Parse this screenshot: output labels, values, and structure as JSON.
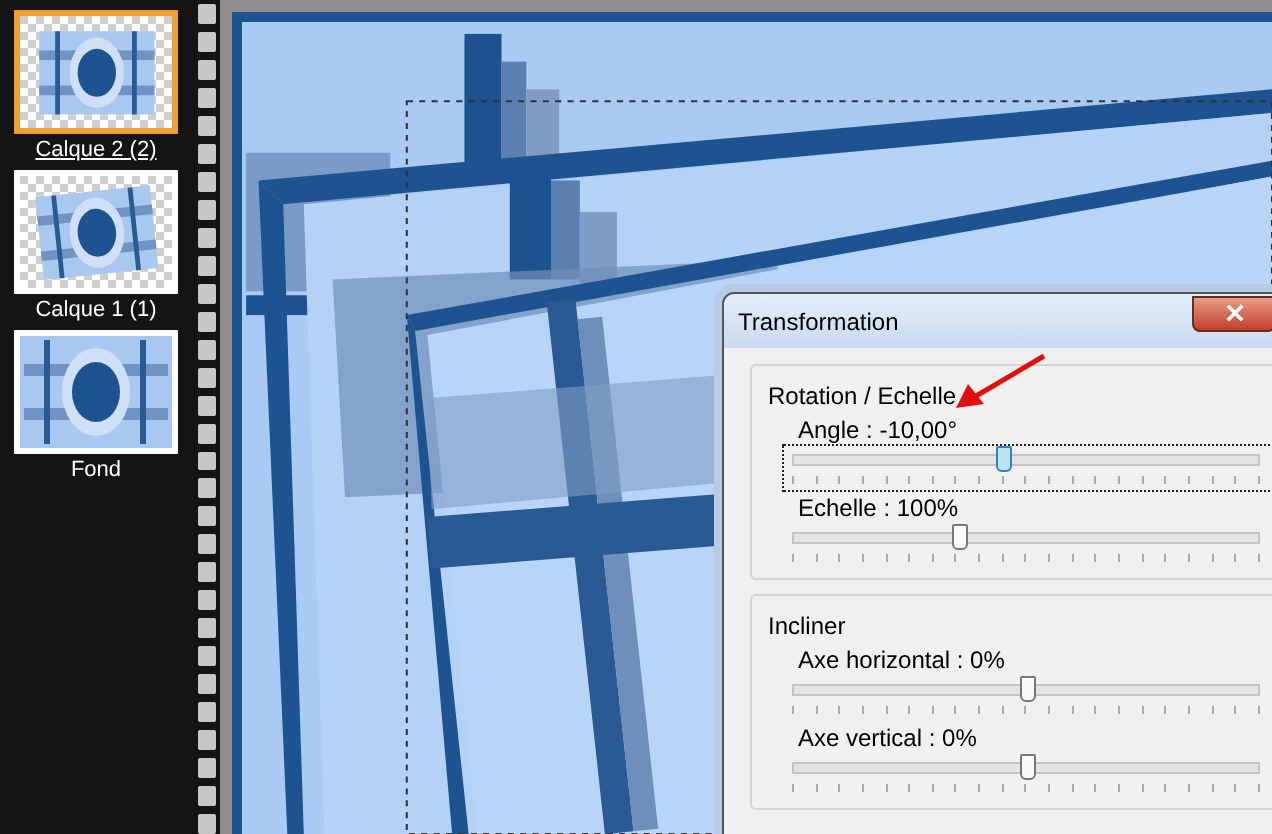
{
  "layers": [
    {
      "name": "Calque 2 (2)",
      "selected": true,
      "transparent": true
    },
    {
      "name": "Calque 1 (1)",
      "selected": false,
      "transparent": true
    },
    {
      "name": "Fond",
      "selected": false,
      "transparent": false
    }
  ],
  "dialog": {
    "title": "Transformation",
    "groups": [
      {
        "title": "Rotation / Echelle",
        "sliders": [
          {
            "label": "Angle : -10,00°",
            "level": 0.45,
            "focused": true
          },
          {
            "label": "Echelle : 100%",
            "level": 0.355,
            "focused": false
          }
        ]
      },
      {
        "title": "Incliner",
        "sliders": [
          {
            "label": "Axe horizontal : 0%",
            "level": 0.5,
            "focused": false
          },
          {
            "label": "Axe vertical : 0%",
            "level": 0.5,
            "focused": false
          }
        ]
      }
    ]
  }
}
